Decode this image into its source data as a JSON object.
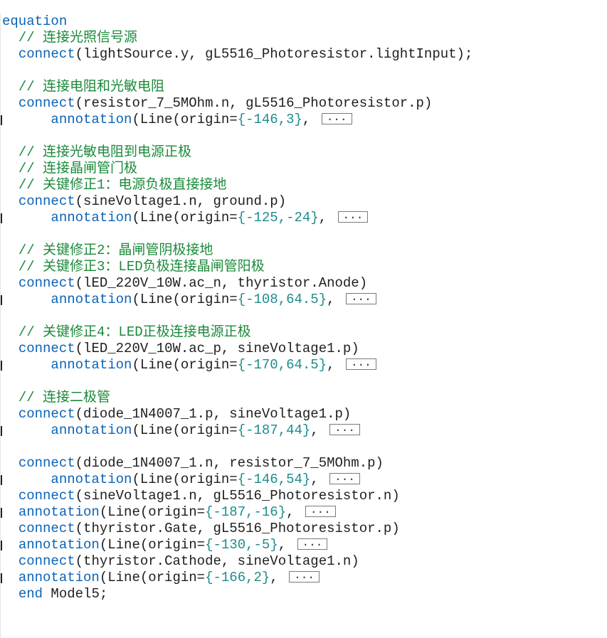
{
  "editor": {
    "keyword_equation": "equation",
    "kw_connect": "connect",
    "kw_annotation": "annotation",
    "kw_end": "end",
    "fold_label": "...",
    "colors": {
      "keyword": "#0b63b6",
      "number": "#1d8c8c",
      "comment": "#1b8a3a",
      "text": "#1e1e1e"
    },
    "lines": [
      {
        "type": "equation",
        "text": "equation"
      },
      {
        "type": "comment",
        "text": "// 连接光照信号源"
      },
      {
        "type": "connect",
        "args": "lightSource.y, gL5516_Photoresistor.lightInput",
        "suffix": ");"
      },
      {
        "type": "blank"
      },
      {
        "type": "comment",
        "text": "// 连接电阻和光敏电阻"
      },
      {
        "type": "connect",
        "args": "resistor_7_5MOhm.n, gL5516_Photoresistor.p",
        "suffix": ")"
      },
      {
        "type": "annotation",
        "indent": "    ",
        "origin": "-146,3"
      },
      {
        "type": "blank"
      },
      {
        "type": "comment",
        "text": "// 连接光敏电阻到电源正极"
      },
      {
        "type": "comment",
        "text": "// 连接晶闸管门极"
      },
      {
        "type": "comment",
        "text": "// 关键修正1：电源负极直接接地"
      },
      {
        "type": "connect",
        "args": "sineVoltage1.n, ground.p",
        "suffix": ")"
      },
      {
        "type": "annotation",
        "indent": "    ",
        "origin": "-125,-24"
      },
      {
        "type": "blank"
      },
      {
        "type": "comment",
        "text": "// 关键修正2：晶闸管阴极接地"
      },
      {
        "type": "comment",
        "text": "// 关键修正3：LED负极连接晶闸管阳极"
      },
      {
        "type": "connect",
        "args": "lED_220V_10W.ac_n, thyristor.Anode",
        "suffix": ")"
      },
      {
        "type": "annotation",
        "indent": "    ",
        "origin": "-108,64.5"
      },
      {
        "type": "blank"
      },
      {
        "type": "comment",
        "text": "// 关键修正4：LED正极连接电源正极"
      },
      {
        "type": "connect",
        "args": "lED_220V_10W.ac_p, sineVoltage1.p",
        "suffix": ")"
      },
      {
        "type": "annotation",
        "indent": "    ",
        "origin": "-170,64.5"
      },
      {
        "type": "blank"
      },
      {
        "type": "comment",
        "text": "// 连接二极管"
      },
      {
        "type": "connect",
        "args": "diode_1N4007_1.p, sineVoltage1.p",
        "suffix": ")"
      },
      {
        "type": "annotation",
        "indent": "    ",
        "origin": "-187,44"
      },
      {
        "type": "blank"
      },
      {
        "type": "connect",
        "args": "diode_1N4007_1.n, resistor_7_5MOhm.p",
        "suffix": ")"
      },
      {
        "type": "annotation",
        "indent": "    ",
        "origin": "-146,54"
      },
      {
        "type": "connect",
        "args": "sineVoltage1.n, gL5516_Photoresistor.n",
        "suffix": ")"
      },
      {
        "type": "annotation",
        "indent": "",
        "origin": "-187,-16"
      },
      {
        "type": "connect",
        "args": "thyristor.Gate, gL5516_Photoresistor.p",
        "suffix": ")"
      },
      {
        "type": "annotation",
        "indent": "",
        "origin": "-130,-5"
      },
      {
        "type": "connect",
        "args": "thyristor.Cathode, sineVoltage1.n",
        "suffix": ")"
      },
      {
        "type": "annotation",
        "indent": "",
        "origin": "-166,2"
      },
      {
        "type": "end",
        "text": " Model5;"
      }
    ]
  }
}
